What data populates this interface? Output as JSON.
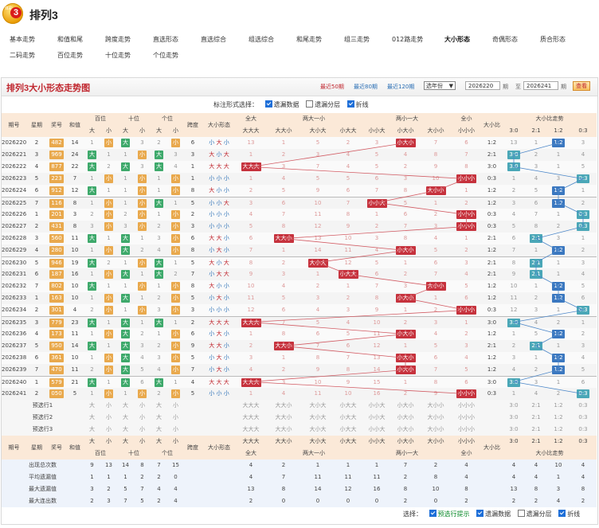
{
  "app": {
    "title": "排列3",
    "logo_text": "体彩"
  },
  "nav": {
    "row1": [
      "基本走势",
      "和值和尾",
      "跨度走势",
      "直选形态",
      "直选综合",
      "组选综合",
      "和尾走势",
      "组三走势",
      "012路走势",
      "大小形态",
      "奇偶形态",
      "质合形态"
    ],
    "row2": [
      "二码走势",
      "百位走势",
      "十位走势",
      "个位走势"
    ],
    "active": "大小形态"
  },
  "panel": {
    "title": "排列3大小形态走势图",
    "recent": [
      "最近50期",
      "最近80期",
      "最近120期"
    ],
    "select": "选年份",
    "from": "2026220",
    "from_unit": "期",
    "to_label": "至",
    "to": "2026241",
    "to_unit": "期",
    "query": "查看"
  },
  "options": {
    "label": "标注形式选择：",
    "items": [
      {
        "label": "遗漏数据",
        "on": true
      },
      {
        "label": "遗漏分层",
        "on": false
      },
      {
        "label": "折线",
        "on": true
      }
    ]
  },
  "headers": {
    "period": "期号",
    "week": "星期",
    "prize": "奖号",
    "sum": "和值",
    "bai": "百位",
    "shi": "十位",
    "ge": "个位",
    "da": "大",
    "xiao": "小",
    "span": "跨度",
    "shape": "大小形态",
    "all_big": "全大",
    "two_big": "两大一小",
    "two_small": "两小一大",
    "all_small": "全小",
    "ratio": "大小比",
    "ratio_trend": "大小比走势",
    "shapes": [
      "大大大",
      "大大小",
      "大小大",
      "小大大",
      "小小大",
      "小大小",
      "大小小",
      "小小小"
    ],
    "ratios": [
      "3:0",
      "2:1",
      "1:2",
      "0:3"
    ]
  },
  "rows": [
    {
      "p": "2026220",
      "w": "2",
      "n": "482",
      "s": "14",
      "b": [
        1,
        "小"
      ],
      "t": [
        "大",
        3
      ],
      "g": [
        2,
        "小"
      ],
      "sp": "6",
      "f": "小大小",
      "z": [
        13,
        1,
        5,
        2,
        3,
        "小大小",
        7,
        6
      ],
      "r": "1:2",
      "rt": [
        13,
        1,
        "1:2",
        3
      ]
    },
    {
      "p": "2026221",
      "w": "3",
      "n": "969",
      "s": "24",
      "b": [
        "大",
        1
      ],
      "t": [
        1,
        "小"
      ],
      "g": [
        "大",
        3
      ],
      "sp": "3",
      "f": "大小大",
      "z": [
        1,
        2,
        3,
        4,
        5,
        4,
        8,
        7
      ],
      "r": "2:1",
      "rt": [
        "3:0",
        2,
        1,
        4
      ]
    },
    {
      "p": "2026222",
      "w": "4",
      "n": "877",
      "s": "22",
      "b": [
        "大",
        2
      ],
      "t": [
        "大",
        3
      ],
      "g": [
        "大",
        4
      ],
      "sp": "1",
      "f": "大大大",
      "z": [
        "大大大",
        3,
        7,
        4,
        5,
        2,
        9,
        8
      ],
      "r": "3:0",
      "rt": [
        "3:0",
        3,
        1,
        5
      ]
    },
    {
      "p": "2026223",
      "w": "5",
      "n": "223",
      "s": "7",
      "b": [
        1,
        "小"
      ],
      "t": [
        1,
        "小"
      ],
      "g": [
        1,
        "小"
      ],
      "sp": "1",
      "f": "小小小",
      "z": [
        1,
        4,
        5,
        5,
        6,
        3,
        10,
        "小小小"
      ],
      "r": "0:3",
      "rt": [
        1,
        4,
        3,
        "0:3"
      ]
    },
    {
      "p": "2026224",
      "w": "6",
      "n": "912",
      "s": "12",
      "b": [
        "大",
        1
      ],
      "t": [
        1,
        "小"
      ],
      "g": [
        1,
        "小"
      ],
      "sp": "8",
      "f": "大小小",
      "z": [
        2,
        5,
        9,
        6,
        7,
        8,
        "大小小",
        1
      ],
      "r": "1:2",
      "rt": [
        2,
        5,
        "1:2",
        1
      ]
    },
    {
      "p": "2026225",
      "w": "7",
      "n": "116",
      "s": "8",
      "b": [
        1,
        "小"
      ],
      "t": [
        1,
        "小"
      ],
      "g": [
        "大",
        1
      ],
      "sp": "5",
      "f": "小小大",
      "z": [
        3,
        6,
        10,
        7,
        "小小大",
        5,
        1,
        2
      ],
      "r": "1:2",
      "rt": [
        3,
        6,
        "1:2",
        2
      ]
    },
    {
      "p": "2026226",
      "w": "1",
      "n": "201",
      "s": "3",
      "b": [
        2,
        "小"
      ],
      "t": [
        2,
        "小"
      ],
      "g": [
        1,
        "小"
      ],
      "sp": "2",
      "f": "小小小",
      "z": [
        4,
        7,
        11,
        8,
        1,
        6,
        2,
        "小小小"
      ],
      "r": "0:3",
      "rt": [
        4,
        7,
        1,
        "0:3"
      ]
    },
    {
      "p": "2026227",
      "w": "2",
      "n": "431",
      "s": "8",
      "b": [
        3,
        "小"
      ],
      "t": [
        3,
        "小"
      ],
      "g": [
        2,
        "小"
      ],
      "sp": "3",
      "f": "小小小",
      "z": [
        5,
        8,
        12,
        9,
        2,
        7,
        3,
        "小小小"
      ],
      "r": "0:3",
      "rt": [
        5,
        8,
        2,
        "0:3"
      ]
    },
    {
      "p": "2026228",
      "w": "3",
      "n": "560",
      "s": "11",
      "b": [
        "大",
        1
      ],
      "t": [
        "大",
        1
      ],
      "g": [
        3,
        "小"
      ],
      "sp": "6",
      "f": "大大小",
      "z": [
        6,
        "大大小",
        13,
        10,
        3,
        8,
        4,
        1
      ],
      "r": "2:1",
      "rt": [
        6,
        "2:1",
        3,
        1
      ]
    },
    {
      "p": "2026229",
      "w": "4",
      "n": "280",
      "s": "10",
      "b": [
        1,
        "小"
      ],
      "t": [
        "大",
        2
      ],
      "g": [
        4,
        "小"
      ],
      "sp": "8",
      "f": "小大小",
      "z": [
        7,
        1,
        14,
        11,
        4,
        "小大小",
        5,
        2
      ],
      "r": "1:2",
      "rt": [
        7,
        1,
        "1:2",
        2
      ]
    },
    {
      "p": "2026230",
      "w": "5",
      "n": "946",
      "s": "19",
      "b": [
        "大",
        2
      ],
      "t": [
        1,
        "小"
      ],
      "g": [
        "大",
        1
      ],
      "sp": "5",
      "f": "大小大",
      "z": [
        8,
        2,
        "大小大",
        12,
        5,
        1,
        6,
        3
      ],
      "r": "2:1",
      "rt": [
        8,
        "2:1",
        1,
        3
      ]
    },
    {
      "p": "2026231",
      "w": "6",
      "n": "187",
      "s": "16",
      "b": [
        1,
        "小"
      ],
      "t": [
        "大",
        1
      ],
      "g": [
        "大",
        2
      ],
      "sp": "7",
      "f": "小大大",
      "z": [
        9,
        3,
        1,
        "小大大",
        6,
        2,
        7,
        4
      ],
      "r": "2:1",
      "rt": [
        9,
        "2:1",
        1,
        4
      ]
    },
    {
      "p": "2026232",
      "w": "7",
      "n": "802",
      "s": "10",
      "b": [
        "大",
        1
      ],
      "t": [
        1,
        "小"
      ],
      "g": [
        1,
        "小"
      ],
      "sp": "8",
      "f": "大小小",
      "z": [
        10,
        4,
        2,
        1,
        7,
        3,
        "大小小",
        5
      ],
      "r": "1:2",
      "rt": [
        10,
        1,
        "1:2",
        5
      ]
    },
    {
      "p": "2026233",
      "w": "1",
      "n": "163",
      "s": "10",
      "b": [
        1,
        "小"
      ],
      "t": [
        "大",
        1
      ],
      "g": [
        2,
        "小"
      ],
      "sp": "5",
      "f": "小大小",
      "z": [
        11,
        5,
        3,
        2,
        8,
        "小大小",
        1,
        6
      ],
      "r": "1:2",
      "rt": [
        11,
        2,
        "1:2",
        6
      ]
    },
    {
      "p": "2026234",
      "w": "2",
      "n": "301",
      "s": "4",
      "b": [
        2,
        "小"
      ],
      "t": [
        1,
        "小"
      ],
      "g": [
        3,
        "小"
      ],
      "sp": "3",
      "f": "小小小",
      "z": [
        12,
        6,
        4,
        3,
        9,
        1,
        2,
        "小小小"
      ],
      "r": "0:3",
      "rt": [
        12,
        3,
        1,
        "0:3"
      ]
    },
    {
      "p": "2026235",
      "w": "3",
      "n": "779",
      "s": "23",
      "b": [
        "大",
        1
      ],
      "t": [
        "大",
        1
      ],
      "g": [
        "大",
        1
      ],
      "sp": "2",
      "f": "大大大",
      "z": [
        "大大大",
        7,
        5,
        4,
        10,
        2,
        3,
        1
      ],
      "r": "3:0",
      "rt": [
        "3:0",
        4,
        2,
        1
      ]
    },
    {
      "p": "2026236",
      "w": "4",
      "n": "173",
      "s": "11",
      "b": [
        1,
        "小"
      ],
      "t": [
        "大",
        2
      ],
      "g": [
        1,
        "小"
      ],
      "sp": "6",
      "f": "小大小",
      "z": [
        1,
        8,
        6,
        5,
        11,
        "小大小",
        4,
        2
      ],
      "r": "1:2",
      "rt": [
        1,
        5,
        "1:2",
        2
      ]
    },
    {
      "p": "2026237",
      "w": "5",
      "n": "950",
      "s": "14",
      "b": [
        "大",
        1
      ],
      "t": [
        "大",
        3
      ],
      "g": [
        2,
        "小"
      ],
      "sp": "9",
      "f": "大大小",
      "z": [
        2,
        "大大小",
        7,
        6,
        12,
        1,
        5,
        3
      ],
      "r": "2:1",
      "rt": [
        2,
        "2:1",
        1,
        3
      ]
    },
    {
      "p": "2026238",
      "w": "6",
      "n": "361",
      "s": "10",
      "b": [
        1,
        "小"
      ],
      "t": [
        "大",
        4
      ],
      "g": [
        3,
        "小"
      ],
      "sp": "5",
      "f": "小大小",
      "z": [
        3,
        1,
        8,
        7,
        13,
        "小大小",
        6,
        4
      ],
      "r": "1:2",
      "rt": [
        3,
        1,
        "1:2",
        4
      ]
    },
    {
      "p": "2026239",
      "w": "7",
      "n": "470",
      "s": "11",
      "b": [
        2,
        "小"
      ],
      "t": [
        "大",
        5
      ],
      "g": [
        4,
        "小"
      ],
      "sp": "7",
      "f": "小大小",
      "z": [
        4,
        2,
        9,
        8,
        14,
        "小大小",
        7,
        5
      ],
      "r": "1:2",
      "rt": [
        4,
        2,
        "1:2",
        5
      ]
    },
    {
      "p": "2026240",
      "w": "1",
      "n": "579",
      "s": "21",
      "b": [
        "大",
        1
      ],
      "t": [
        "大",
        6
      ],
      "g": [
        "大",
        1
      ],
      "sp": "4",
      "f": "大大大",
      "z": [
        "大大大",
        3,
        10,
        9,
        15,
        1,
        8,
        6
      ],
      "r": "3:0",
      "rt": [
        "3:0",
        3,
        1,
        6
      ]
    },
    {
      "p": "2026241",
      "w": "2",
      "n": "050",
      "s": "5",
      "b": [
        1,
        "小"
      ],
      "t": [
        1,
        "小"
      ],
      "g": [
        2,
        "小"
      ],
      "sp": "5",
      "f": "小小小",
      "z": [
        1,
        4,
        11,
        10,
        16,
        2,
        9,
        "小小小"
      ],
      "r": "0:3",
      "rt": [
        1,
        4,
        2,
        "0:3"
      ]
    }
  ],
  "pred": {
    "labels": [
      "预选行1",
      "预选行2",
      "预选行3"
    ]
  },
  "stats": {
    "labels": [
      "出现总次数",
      "平均遗漏值",
      "最大遗漏值",
      "最大连出数"
    ],
    "bai": [
      [
        "9",
        "13"
      ],
      [
        "1",
        "1"
      ],
      [
        "3",
        "2"
      ],
      [
        "2",
        "3"
      ]
    ],
    "shi": [
      [
        "14",
        "8"
      ],
      [
        "1",
        "2"
      ],
      [
        "5",
        "7"
      ],
      [
        "7",
        "5"
      ]
    ],
    "ge": [
      [
        "7",
        "15"
      ],
      [
        "2",
        "0"
      ],
      [
        "4",
        "4"
      ],
      [
        "2",
        "4"
      ]
    ],
    "z": [
      [
        "4",
        "2",
        "1",
        "1",
        "1",
        "7",
        "2",
        "4"
      ],
      [
        "4",
        "7",
        "11",
        "11",
        "11",
        "2",
        "8",
        "4"
      ],
      [
        "13",
        "8",
        "14",
        "12",
        "16",
        "8",
        "10",
        "8"
      ],
      [
        "2",
        "0",
        "0",
        "0",
        "0",
        "2",
        "0",
        "2"
      ]
    ],
    "rt": [
      [
        "4",
        "4",
        "10",
        "4"
      ],
      [
        "4",
        "4",
        "1",
        "4"
      ],
      [
        "13",
        "8",
        "3",
        "8"
      ],
      [
        "2",
        "2",
        "4",
        "2"
      ]
    ]
  },
  "bottom": {
    "label": "选择：",
    "items": [
      {
        "label": "预选行提示",
        "on": true,
        "green": true
      },
      {
        "label": "遗漏数据",
        "on": true
      },
      {
        "label": "遗漏分层",
        "on": false
      },
      {
        "label": "折线",
        "on": true
      }
    ]
  },
  "colors": {
    "accent": "#c0262e",
    "green": "#3ea96b",
    "orange": "#e9a94d",
    "red": "#c6323d",
    "teal": "#4aa7b7",
    "blue": "#3b78c0"
  }
}
